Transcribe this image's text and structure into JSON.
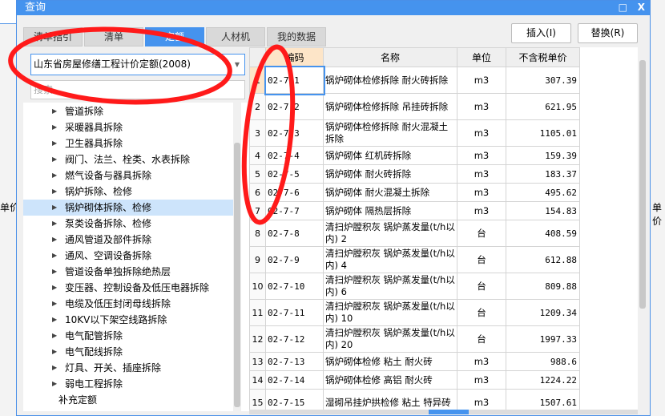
{
  "background": {
    "left_label": "单价",
    "right_label": "单价"
  },
  "dialog": {
    "title": "查询",
    "maximize": "□",
    "close": "X"
  },
  "tabs": [
    {
      "label": "清单指引"
    },
    {
      "label": "清单"
    },
    {
      "label": "定额",
      "active": true
    },
    {
      "label": "人材机"
    },
    {
      "label": "我的数据"
    }
  ],
  "buttons": {
    "insert": "插入(I)",
    "replace": "替换(R)"
  },
  "library": {
    "selected": "山东省房屋修缮工程计价定额(2008)"
  },
  "search": {
    "placeholder": "搜索"
  },
  "tree": [
    {
      "label": "管道拆除"
    },
    {
      "label": "采暖器具拆除"
    },
    {
      "label": "卫生器具拆除"
    },
    {
      "label": "阀门、法兰、栓类、水表拆除"
    },
    {
      "label": "燃气设备与器具拆除"
    },
    {
      "label": "锅炉拆除、检修"
    },
    {
      "label": "锅炉砌体拆除、检修",
      "selected": true
    },
    {
      "label": "泵类设备拆除、检修"
    },
    {
      "label": "通风管道及部件拆除"
    },
    {
      "label": "通风、空调设备拆除"
    },
    {
      "label": "管道设备单独拆除绝热层"
    },
    {
      "label": "变压器、控制设备及低压电器拆除"
    },
    {
      "label": "电缆及低压封闭母线拆除"
    },
    {
      "label": "10KV以下架空线路拆除"
    },
    {
      "label": "电气配管拆除"
    },
    {
      "label": "电气配线拆除"
    },
    {
      "label": "灯具、开关、插座拆除"
    },
    {
      "label": "弱电工程拆除"
    },
    {
      "label": "补充定额",
      "leaf": true
    }
  ],
  "table": {
    "headers": [
      "",
      "编码",
      "名称",
      "单位",
      "不含税单价"
    ],
    "rows": [
      {
        "n": "1",
        "code": "02-7-1",
        "name": "锅炉砌体检修拆除 耐火砖拆除",
        "unit": "m3",
        "price": "307.39"
      },
      {
        "n": "2",
        "code": "02-7-2",
        "name": "锅炉砌体检修拆除 吊挂砖拆除",
        "unit": "m3",
        "price": "621.95"
      },
      {
        "n": "3",
        "code": "02-7-3",
        "name": "锅炉砌体检修拆除 耐火混凝土拆除",
        "unit": "m3",
        "price": "1105.01"
      },
      {
        "n": "4",
        "code": "02-7-4",
        "name": "锅炉砌体 红机砖拆除",
        "unit": "m3",
        "price": "159.39"
      },
      {
        "n": "5",
        "code": "02-7-5",
        "name": "锅炉砌体 耐火砖拆除",
        "unit": "m3",
        "price": "183.37"
      },
      {
        "n": "6",
        "code": "02-7-6",
        "name": "锅炉砌体 耐火混凝土拆除",
        "unit": "m3",
        "price": "495.62"
      },
      {
        "n": "7",
        "code": "02-7-7",
        "name": "锅炉砌体 隔热层拆除",
        "unit": "m3",
        "price": "154.83"
      },
      {
        "n": "8",
        "code": "02-7-8",
        "name": "清扫炉膛积灰 锅炉蒸发量(t/h以内) 2",
        "unit": "台",
        "price": "408.59"
      },
      {
        "n": "9",
        "code": "02-7-9",
        "name": "清扫炉膛积灰 锅炉蒸发量(t/h以内) 4",
        "unit": "台",
        "price": "612.88"
      },
      {
        "n": "10",
        "code": "02-7-10",
        "name": "清扫炉膛积灰 锅炉蒸发量(t/h以内) 6",
        "unit": "台",
        "price": "809.88"
      },
      {
        "n": "11",
        "code": "02-7-11",
        "name": "清扫炉膛积灰 锅炉蒸发量(t/h以内) 10",
        "unit": "台",
        "price": "1209.34"
      },
      {
        "n": "12",
        "code": "02-7-12",
        "name": "清扫炉膛积灰 锅炉蒸发量(t/h以内) 20",
        "unit": "台",
        "price": "1997.33"
      },
      {
        "n": "13",
        "code": "02-7-13",
        "name": "锅炉砌体检修 粘土 耐火砖",
        "unit": "m3",
        "price": "988.6"
      },
      {
        "n": "14",
        "code": "02-7-14",
        "name": "锅炉砌体检修 高铝 耐火砖",
        "unit": "m3",
        "price": "1224.22"
      },
      {
        "n": "15",
        "code": "02-7-15",
        "name": "湿砌吊挂炉拱检修 粘土 特异砖",
        "unit": "m3",
        "price": "1507.61"
      }
    ]
  },
  "colors": {
    "accent": "#4593ee",
    "annotation": "#ff1a1a"
  }
}
